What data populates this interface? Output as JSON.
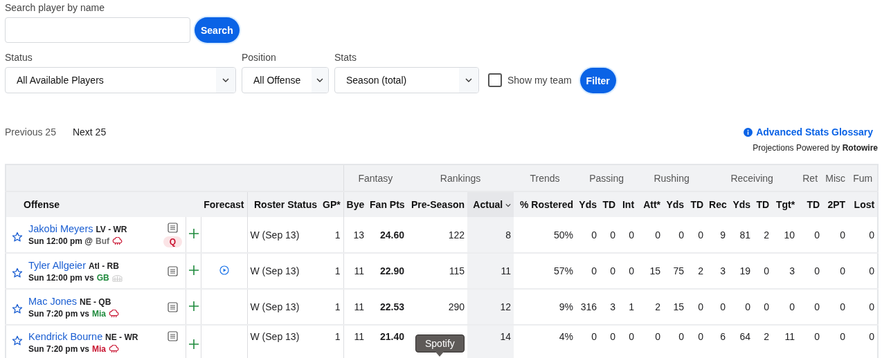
{
  "search": {
    "label": "Search player by name",
    "button": "Search"
  },
  "filters": [
    {
      "label": "Status",
      "value": "All Available Players"
    },
    {
      "label": "Position",
      "value": "All Offense"
    },
    {
      "label": "Stats",
      "value": "Season (total)"
    }
  ],
  "show_my_team": {
    "label": "Show my team",
    "checked": false
  },
  "filter_button": "Filter",
  "pager": {
    "previous": "Previous 25",
    "next": "Next 25"
  },
  "glossary_link": "Advanced Stats Glossary",
  "projections_note": "Projections Powered by **Rotowire**",
  "table": {
    "groups": [
      {
        "columns": [
          "Offense",
          "Forecast",
          "Roster Status",
          "GP*"
        ]
      },
      {
        "label": "Fantasy",
        "columns": [
          "Bye",
          "Fan Pts"
        ]
      },
      {
        "label": "Rankings",
        "columns": [
          "Pre-Season",
          "Actual"
        ],
        "sorted": [
          false,
          true
        ]
      },
      {
        "label": "Trends",
        "columns": [
          "% Rostered"
        ]
      },
      {
        "label": "Passing",
        "columns": [
          "Yds",
          "TD",
          "Int"
        ]
      },
      {
        "label": "Rushing",
        "columns": [
          "Att*",
          "Yds",
          "TD"
        ]
      },
      {
        "label": "Receiving",
        "columns": [
          "Rec",
          "Yds",
          "TD",
          "Tgt*"
        ]
      },
      {
        "label": "Ret",
        "columns": [
          "TD"
        ]
      },
      {
        "label": "Misc",
        "columns": [
          "2PT"
        ]
      },
      {
        "label": "Fum",
        "columns": [
          "Lost"
        ]
      }
    ],
    "rows": [
      {
        "name": "Jakobi Meyers",
        "team_pos": "LV - WR",
        "game": "Sun 12:00 pm @",
        "opponent": {
          "name": "Buf",
          "color": "#6b6b6b"
        },
        "weather": {
          "kind": "rain"
        },
        "injury": "Q",
        "forecast_video": false,
        "roster_status": "W (Sep 13)",
        "gp": "1",
        "bye": "13",
        "fan_pts": "24.60",
        "pre_season": "122",
        "actual": "8",
        "rostered": "50%",
        "stats": [
          "0",
          "0",
          "0",
          "0",
          "0",
          "0",
          "9",
          "81",
          "2",
          "10",
          "0",
          "0",
          "0"
        ]
      },
      {
        "name": "Tyler Allgeier",
        "team_pos": "Atl - RB",
        "game": "Sun 12:00 pm vs",
        "opponent": {
          "name": "GB",
          "color": "#1e8a3c"
        },
        "weather": {
          "kind": "dome"
        },
        "forecast_video": true,
        "roster_status": "W (Sep 13)",
        "gp": "1",
        "bye": "11",
        "fan_pts": "22.90",
        "pre_season": "115",
        "actual": "11",
        "rostered": "57%",
        "stats": [
          "0",
          "0",
          "0",
          "15",
          "75",
          "2",
          "3",
          "19",
          "0",
          "3",
          "0",
          "0",
          "0"
        ]
      },
      {
        "name": "Mac Jones",
        "team_pos": "NE - QB",
        "game": "Sun 7:20 pm vs",
        "opponent": {
          "name": "Mia",
          "color": "#1e8a3c"
        },
        "weather": {
          "kind": "rain"
        },
        "forecast_video": false,
        "roster_status": "W (Sep 13)",
        "gp": "1",
        "bye": "11",
        "fan_pts": "22.53",
        "pre_season": "290",
        "actual": "12",
        "rostered": "9%",
        "stats": [
          "316",
          "3",
          "1",
          "2",
          "15",
          "0",
          "0",
          "0",
          "0",
          "0",
          "0",
          "0",
          "0"
        ]
      },
      {
        "name": "Kendrick Bourne",
        "team_pos": "NE - WR",
        "game": "Sun 7:20 pm vs",
        "opponent": {
          "name": "Mia",
          "color": "#c8102e"
        },
        "weather": {
          "kind": "rain"
        },
        "forecast_video": false,
        "roster_status": "W (Sep 13)",
        "gp": "1",
        "bye": "11",
        "fan_pts": "21.40",
        "actual": "14",
        "rostered": "4%",
        "stats": [
          "0",
          "0",
          "0",
          "0",
          "0",
          "0",
          "6",
          "64",
          "2",
          "11",
          "0",
          "0",
          "0"
        ]
      }
    ]
  },
  "tooltip": "Spotify"
}
